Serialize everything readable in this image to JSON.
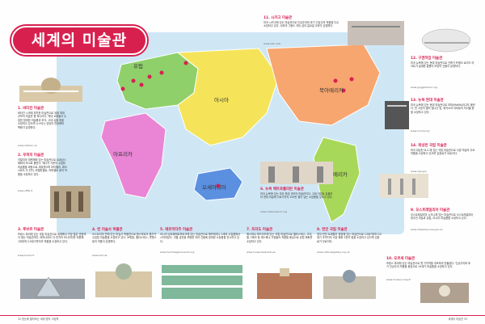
{
  "title": "세계의 미술관",
  "continents": {
    "europe": "유럽",
    "asia": "아시아",
    "africa": "아프리카",
    "oceania": "오세아니아",
    "north_america": "북아메리카",
    "south_america": "남아메리카"
  },
  "museums": [
    {
      "title": "1. 바티칸 미술관",
      "body": "바티칸 시국에 위치한 미술관으로 세계 최대 규모의 미술관 중 하나이다. 역대 교황들이 수집한 방대한 미술품과 조각, 고대 유물 등을 소장하고 있으며 시스티나 성당의 천장화와 벽화가 유명하다.",
      "url": "www.vatican.va"
    },
    {
      "title": "2. 우피치 미술관",
      "body": "이탈리아 피렌체에 있는 미술관으로 르네상스 회화의 보고로 불린다. 메디치 가문이 수집한 미술품을 바탕으로 세워졌으며 보티첼리, 레오나르도 다 빈치, 미켈란젤로, 라파엘로 등의 작품을 소장하고 있다.",
      "url": "www.uffizi.it"
    },
    {
      "title": "3. 루브르 미술관",
      "body": "프랑스 파리에 있는 국립 미술관으로 세계에서 가장 많은 관람객이 찾는 미술관이다. 레오나르도 다 빈치의 모나리자를 비롯해 고대부터 19세기까지의 작품을 소장하고 있다.",
      "url": "www.louvre.fr"
    },
    {
      "title": "4. 런 미술사 박물관",
      "body": "오스트리아 빈에 있는 미술사 박물관으로 합스부르크 왕가가 수집한 미술품을 소장하고 있다. 브뤼헐, 벨라스케스, 루벤스 등의 작품이 유명하다.",
      "url": "www.khm.at"
    },
    {
      "title": "5. 에르미타주 미술관",
      "body": "러시아 상트페테르부르크에 있는 미술관으로 예카테리나 2세의 수집품에서 시작되었다. 겨울 궁전을 포함한 여러 건물에 방대한 소장품을 전시하고 있다.",
      "url": "www.hermitagemuseum.org"
    },
    {
      "title": "6. 뉴욕 메트로폴리탄 미술관",
      "body": "미국 뉴욕에 있는 미국 최대 규모의 미술관이다. 고대 이집트 유물부터 현대 미술에 이르기까지 200만 점이 넘는 소장품을 갖추고 있다.",
      "url": "www.metmuseum.org"
    },
    {
      "title": "7. 프라도 미술관",
      "body": "에스파냐 마드리드에 있는 국립 미술관으로 벨라스케스, 고야, 엘 그레코 등 에스파냐 거장들의 작품을 중심으로 유럽 회화를 소장하고 있다.",
      "url": "www.museodelprado.es"
    },
    {
      "title": "8. 런던 국립 미술관",
      "body": "영국 런던 트래펄가 광장에 있는 미술관으로 13세기부터 20세기 초까지의 서양 회화 2천여 점을 소장하고 있으며 입장료가 무료이다.",
      "url": "www.nationalgallery.org.uk"
    },
    {
      "title": "9. 오스트레일리아 미술관",
      "body": "오스트레일리아 시드니에 있는 미술관으로 오스트레일리아 원주민 미술과 유럽, 아시아 미술품을 소장하고 있다.",
      "url": "www.artgallery.nsw.gov.au"
    },
    {
      "title": "10. 오르세 미술관",
      "body": "프랑스 파리에 있는 미술관으로 옛 기차역을 개조하여 만들었다. 인상주의와 후기 인상주의 작품을 중심으로 19세기 미술품을 소장하고 있다.",
      "url": "www.musee-orsay.fr"
    },
    {
      "title": "11. 시카고 미술관",
      "body": "미국 시카고에 있는 미술관으로 인상주의와 후기 인상주의 작품을 다수 소장하고 있다. 쇠라의 그랑드 자트 섬의 일요일 오후가 유명하다.",
      "url": "www.artic.edu"
    },
    {
      "title": "12. 구겐하임 미술관",
      "body": "미국 뉴욕에 있는 현대 미술관으로 건축가 프랭크 로이드 라이트가 설계한 달팽이 모양의 건물이 유명하다.",
      "url": "www.guggenheim.org"
    },
    {
      "title": "13. 뉴욕 현대 미술관",
      "body": "미국 뉴욕에 있는 현대 미술관으로 모마(MoMA)라고도 불린다. 반 고흐의 별이 빛나는 밤, 피카소의 아비뇽의 처녀들 등을 소장하고 있다.",
      "url": "www.moma.org"
    },
    {
      "title": "14. 워싱턴 국립 미술관",
      "body": "미국 워싱턴 D.C.에 있는 국립 미술관으로 서양 미술의 주요 작품을 소장하고 있으며 입장료가 무료이다.",
      "url": "www.nga.gov"
    }
  ],
  "footer": {
    "left": "32  한눈에 펼쳐보는 세계 명작 그림책",
    "right": "세계의 미술관  33"
  }
}
